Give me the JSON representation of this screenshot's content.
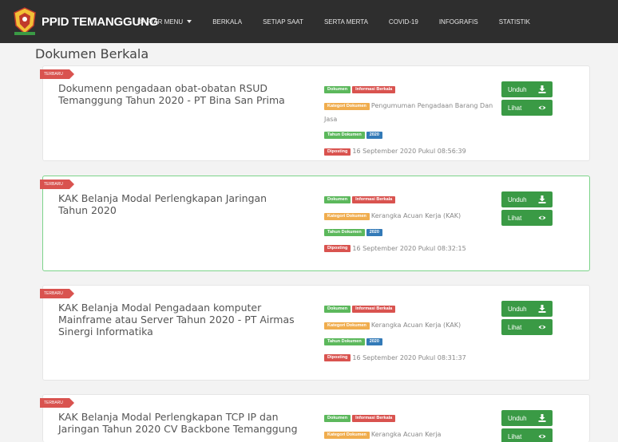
{
  "brand": {
    "name": "PPID TEMANGGUNG",
    "logo_icon": "kak-regency-crest-icon"
  },
  "nav": {
    "items": [
      {
        "label": "DAFTAR MENU",
        "has_caret": true
      },
      {
        "label": "BERKALA"
      },
      {
        "label": "SETIAP SAAT"
      },
      {
        "label": "SERTA MERTA"
      },
      {
        "label": "COVID-19"
      },
      {
        "label": "INFOGRAFIS"
      },
      {
        "label": "STATISTIK"
      }
    ]
  },
  "page": {
    "title": "Dokumen Berkala"
  },
  "labels": {
    "ribbon": "TERBARU",
    "dokumen": "Dokumen",
    "informasi_berkala": "Informasi Berkala",
    "kategori": "Kategori Dokumen",
    "tahun": "Tahun Dokumen",
    "diposting": "Diposting",
    "unduh": "Unduh",
    "lihat": "Lihat"
  },
  "documents": [
    {
      "title": "Dokumenn pengadaan obat-obatan RSUD Temanggung Tahun 2020 - PT Bina San Prima",
      "kategori": "Pengumuman Pengadaan Barang Dan Jasa",
      "tahun": "2020",
      "posted": "16 September 2020 Pukul 08:56:39"
    },
    {
      "title": "KAK Belanja Modal Perlengkapan Jaringan Tahun 2020",
      "kategori": "Kerangka Acuan Kerja (KAK)",
      "tahun": "2020",
      "posted": "16 September 2020 Pukul 08:32:15"
    },
    {
      "title": "KAK Belanja Modal Pengadaan komputer Mainframe atau Server Tahun 2020 - PT Airmas Sinergi Informatika",
      "kategori": "Kerangka Acuan Kerja (KAK)",
      "tahun": "2020",
      "posted": "16 September 2020 Pukul 08:31:37"
    },
    {
      "title": "KAK Belanja Modal Perlengkapan TCP IP dan Jaringan Tahun 2020 CV Backbone Temanggung",
      "kategori": "Kerangka Acuan Kerja",
      "tahun": "",
      "posted": ""
    }
  ],
  "colors": {
    "navbar": "#2e2e2e",
    "button_green": "#3a9a45",
    "badge_red": "#d9534f",
    "badge_orange": "#f0ad4e",
    "badge_blue": "#337ab7",
    "active_border": "#7cd38a"
  }
}
